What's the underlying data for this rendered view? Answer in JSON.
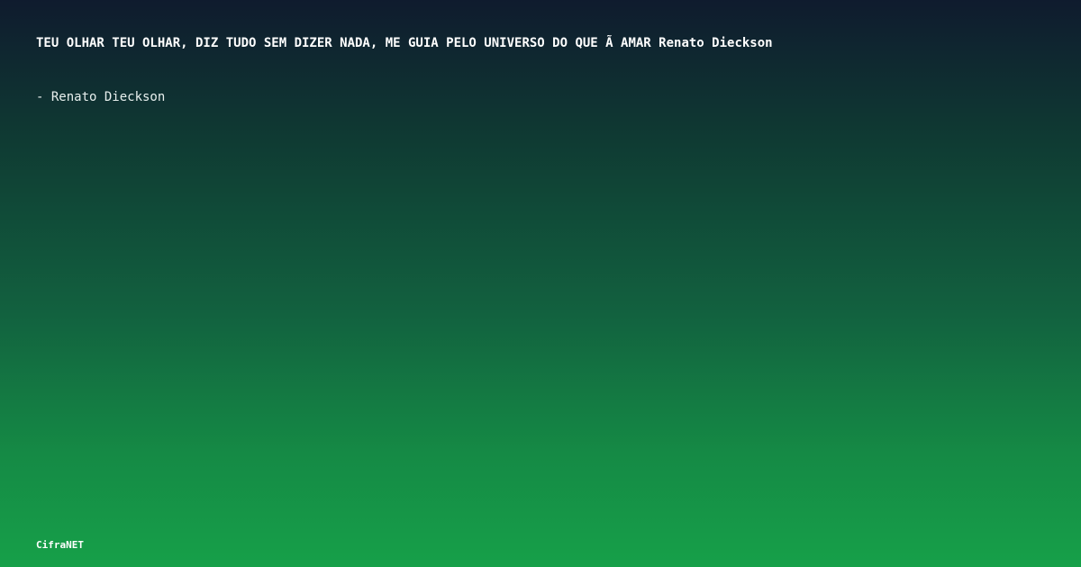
{
  "quote": {
    "text": "TEU OLHAR TEU OLHAR, DIZ TUDO SEM DIZER NADA, ME GUIA PELO UNIVERSO DO QUE Ã  AMAR Renato Dieckson"
  },
  "author": {
    "text": "- Renato Dieckson"
  },
  "brand": {
    "name": "CifraNET"
  },
  "colors": {
    "gradient_top": "#0f1b2e",
    "gradient_bottom": "#16a049",
    "text": "#ffffff"
  }
}
